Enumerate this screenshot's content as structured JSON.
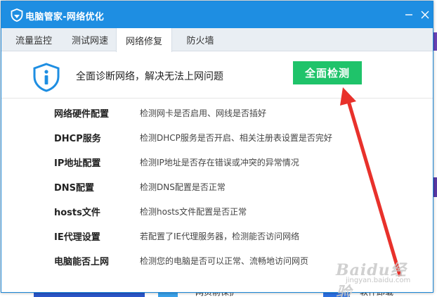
{
  "window": {
    "title": "电脑管家-网络优化",
    "accent": "#1e8ee2"
  },
  "tabs": [
    {
      "label": "流量监控",
      "active": false
    },
    {
      "label": "测试网速",
      "active": false
    },
    {
      "label": "网络修复",
      "active": true
    },
    {
      "label": "防火墙",
      "active": false
    }
  ],
  "diagnosis": {
    "headline": "全面诊断网络，解决无法上网问题",
    "button_label": "全面检测",
    "button_color": "#1fc36a"
  },
  "items": [
    {
      "name": "网络硬件配置",
      "desc": "检测网卡是否启用、网线是否插好"
    },
    {
      "name": "DHCP服务",
      "desc": "检测DHCP服务是否开启、相关注册表设置是否完好"
    },
    {
      "name": "IP地址配置",
      "desc": "检测IP地址是否存在错误或冲突的异常情况"
    },
    {
      "name": "DNS配置",
      "desc": "检测DNS配置是否正常"
    },
    {
      "name": "hosts文件",
      "desc": "检测hosts文件配置是否正常"
    },
    {
      "name": "IE代理设置",
      "desc": "若配置了IE代理服务器，检测能否访问网络"
    },
    {
      "name": "电脑能否上网",
      "desc": "检测您的电脑是否可以正常、流畅地访问网页"
    }
  ],
  "annotation": {
    "arrow_color": "#e8312b"
  },
  "watermark": {
    "big": "Baidu经验",
    "small": "jingyan.baidu.com"
  },
  "background": {
    "bottom_texts": [
      "网页前保护",
      "软件卸载"
    ]
  }
}
